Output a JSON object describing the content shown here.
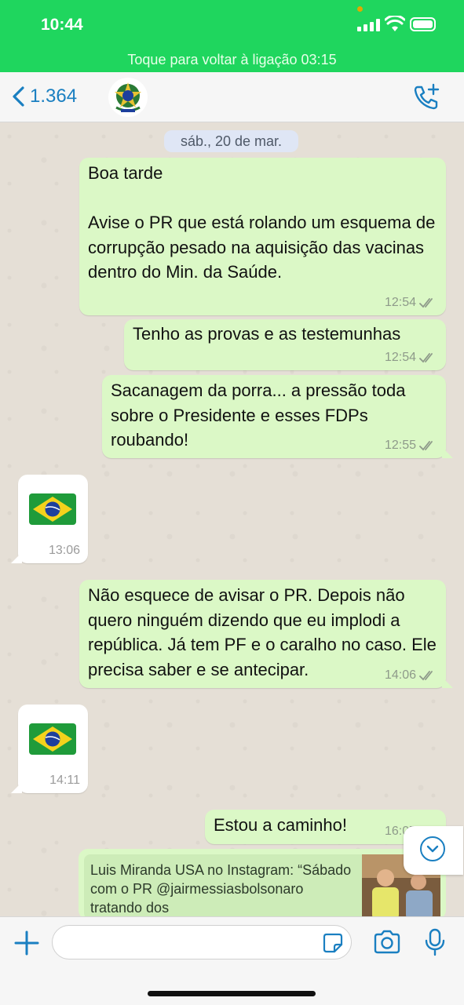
{
  "status_bar": {
    "time": "10:44"
  },
  "call_banner": "Toque para voltar à ligação 03:15",
  "header": {
    "back_count": "1.364"
  },
  "date_chip": "sáb., 20 de mar.",
  "messages": [
    {
      "dir": "out",
      "text": "Boa tarde\n\nAvise o PR que está rolando um esquema de corrupção pesado na aquisição das vacinas dentro do Min. da Saúde.",
      "time": "12:54",
      "read": true
    },
    {
      "dir": "out",
      "text": "Tenho as provas e as testemunhas",
      "time": "12:54",
      "read": true
    },
    {
      "dir": "out",
      "text": "Sacanagem da porra... a pressão toda sobre o Presidente e esses FDPs roubando!",
      "time": "12:55",
      "read": true
    },
    {
      "dir": "in",
      "emoji": "brazil-flag",
      "time": "13:06"
    },
    {
      "dir": "out",
      "text": "Não esquece de avisar o PR. Depois não quero ninguém dizendo que eu implodi a república. Já tem PF e o caralho no caso. Ele precisa saber e se antecipar.",
      "time": "14:06",
      "read": true
    },
    {
      "dir": "in",
      "emoji": "brazil-flag",
      "time": "14:11"
    },
    {
      "dir": "out",
      "text": "Estou a caminho!",
      "time": "16:07",
      "read": true
    }
  ],
  "link_preview": {
    "text": "Luis Miranda USA no Instagram: “Sábado com o PR @jairmessiasbolsonaro tratando dos"
  },
  "composer": {
    "value": "",
    "placeholder": ""
  },
  "colors": {
    "status_green": "#1fd65e",
    "accent": "#1a7fc1",
    "outgoing_bubble": "#dbf8c6",
    "incoming_bubble": "#ffffff"
  }
}
